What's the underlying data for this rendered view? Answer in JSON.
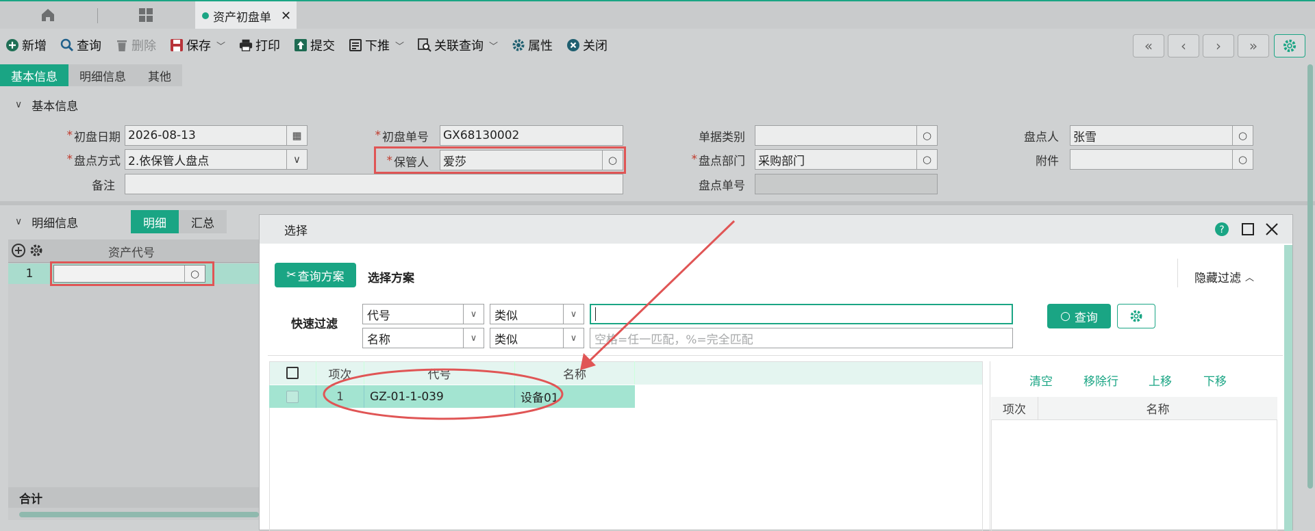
{
  "tabs": {
    "doc_tab_label": "资产初盘单"
  },
  "toolbar": {
    "new": "新增",
    "query": "查询",
    "delete": "删除",
    "save": "保存",
    "print": "打印",
    "submit": "提交",
    "push_down": "下推",
    "related_query": "关联查询",
    "properties": "属性",
    "close": "关闭"
  },
  "section_tabs": [
    "基本信息",
    "明细信息",
    "其他"
  ],
  "basic": {
    "header": "基本信息",
    "init_date_label": "初盘日期",
    "init_date": "2026-08-13",
    "init_no_label": "初盘单号",
    "init_no": "GX68130002",
    "doc_type_label": "单据类别",
    "doc_type": "",
    "counter_label": "盘点人",
    "counter": "张雪",
    "method_label": "盘点方式",
    "method": "2.依保管人盘点",
    "keeper_label": "保管人",
    "keeper": "爱莎",
    "dept_label": "盘点部门",
    "dept": "采购部门",
    "attach_label": "附件",
    "attach": "",
    "remark_label": "备注",
    "remark": "",
    "count_no_label": "盘点单号",
    "count_no": ""
  },
  "detail": {
    "header": "明细信息",
    "tab_detail": "明细",
    "tab_summary": "汇总",
    "col_asset_code": "资产代号",
    "row_no": "1",
    "total_label": "合计"
  },
  "dialog": {
    "title": "选择",
    "query_scheme": "查询方案",
    "select_scheme": "选择方案",
    "hide_filter": "隐藏过滤",
    "quick_filter": "快速过滤",
    "filter1_field": "代号",
    "filter1_op": "类似",
    "filter1_value": "",
    "filter2_field": "名称",
    "filter2_op": "类似",
    "filter2_placeholder": "空格=任一匹配，%=完全匹配",
    "query_btn": "查询",
    "cols": {
      "no": "项次",
      "code": "代号",
      "name": "名称"
    },
    "rows": [
      {
        "no": "1",
        "code": "GZ-01-1-039",
        "name": "设备01"
      }
    ],
    "clear": "清空",
    "remove_row": "移除行",
    "move_up": "上移",
    "move_down": "下移",
    "right_cols": {
      "no": "项次",
      "name": "名称"
    }
  },
  "colors": {
    "accent": "#1aa584",
    "highlight_row": "#a3e4d1",
    "annotation": "#e05555"
  }
}
